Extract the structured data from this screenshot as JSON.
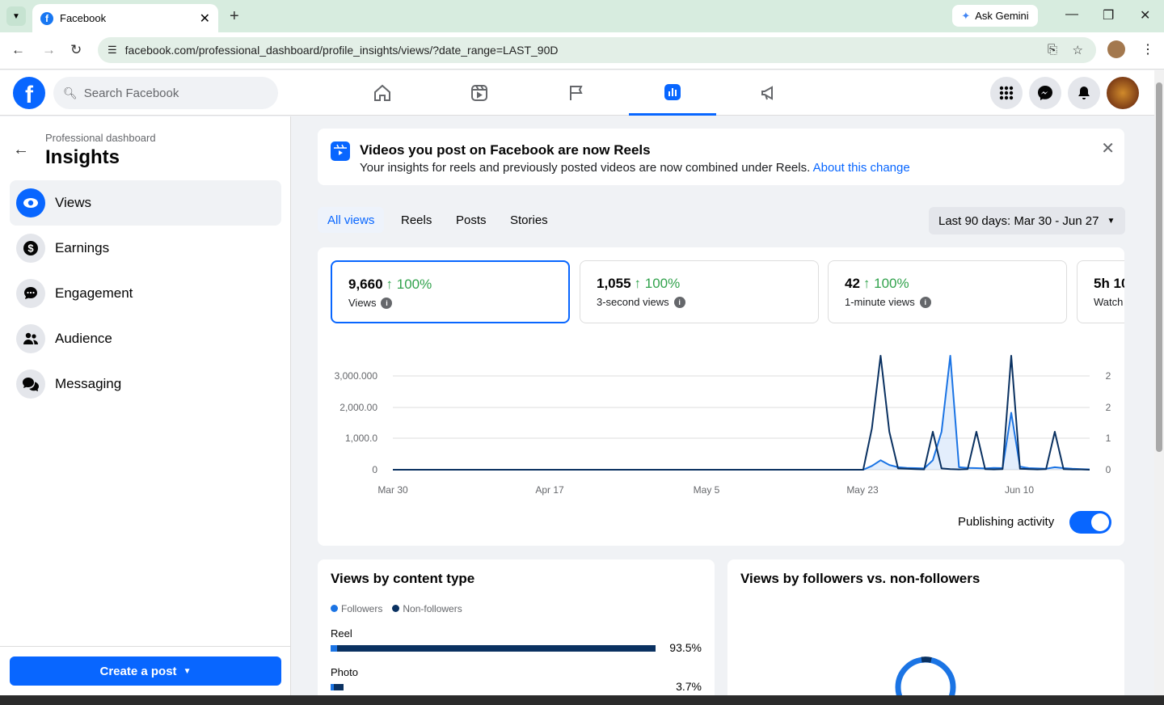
{
  "browser": {
    "tab_title": "Facebook",
    "url": "facebook.com/professional_dashboard/profile_insights/views/?date_range=LAST_90D",
    "gemini_label": "Ask Gemini"
  },
  "fb": {
    "search_placeholder": "Search Facebook"
  },
  "sidebar": {
    "breadcrumb": "Professional dashboard",
    "title": "Insights",
    "items": [
      {
        "label": "Views",
        "icon": "eye-icon"
      },
      {
        "label": "Earnings",
        "icon": "dollar-icon"
      },
      {
        "label": "Engagement",
        "icon": "chat-bubble-icon"
      },
      {
        "label": "Audience",
        "icon": "people-icon"
      },
      {
        "label": "Messaging",
        "icon": "messages-icon"
      }
    ],
    "create_post": "Create a post"
  },
  "banner": {
    "title": "Videos you post on Facebook are now Reels",
    "desc": "Your insights for reels and previously posted videos are now combined under Reels.",
    "link": "About this change"
  },
  "filters": {
    "tabs": [
      "All views",
      "Reels",
      "Posts",
      "Stories"
    ],
    "range": "Last 90 days: Mar 30 - Jun 27"
  },
  "metrics": [
    {
      "value": "9,660",
      "pct": "↑ 100%",
      "label": "Views"
    },
    {
      "value": "1,055",
      "pct": "↑ 100%",
      "label": "3-second views"
    },
    {
      "value": "42",
      "pct": "↑ 100%",
      "label": "1-minute views"
    },
    {
      "value": "5h 10",
      "pct": "",
      "label": "Watch"
    }
  ],
  "publishing_activity": "Publishing activity",
  "chart_data": {
    "type": "line",
    "x_ticks": [
      "Mar 30",
      "Apr 17",
      "May 5",
      "May 23",
      "Jun 10"
    ],
    "y_ticks_left": [
      "3,000.000",
      "2,000.00",
      "1,000.0",
      "0"
    ],
    "y_ticks_right": [
      "2",
      "2",
      "1",
      "0"
    ],
    "ylim": [
      0,
      3000
    ],
    "series": [
      {
        "color": "#1b74e4",
        "values": [
          0,
          0,
          0,
          0,
          0,
          0,
          0,
          0,
          0,
          0,
          0,
          0,
          0,
          0,
          0,
          0,
          0,
          0,
          0,
          0,
          0,
          0,
          0,
          0,
          0,
          0,
          0,
          0,
          0,
          0,
          0,
          0,
          0,
          0,
          0,
          0,
          0,
          0,
          0,
          0,
          0,
          0,
          0,
          0,
          0,
          0,
          0,
          0,
          0,
          0,
          0,
          0,
          0,
          0,
          0,
          120,
          300,
          150,
          80,
          60,
          50,
          40,
          300,
          1200,
          3600,
          80,
          60,
          50,
          40,
          60,
          50,
          1800,
          100,
          50,
          40,
          30,
          80,
          50,
          30,
          20,
          10
        ]
      },
      {
        "color": "#0a3161",
        "values": [
          0,
          0,
          0,
          0,
          0,
          0,
          0,
          0,
          0,
          0,
          0,
          0,
          0,
          0,
          0,
          0,
          0,
          0,
          0,
          0,
          0,
          0,
          0,
          0,
          0,
          0,
          0,
          0,
          0,
          0,
          0,
          0,
          0,
          0,
          0,
          0,
          0,
          0,
          0,
          0,
          0,
          0,
          0,
          0,
          0,
          0,
          0,
          0,
          0,
          0,
          0,
          0,
          0,
          0,
          0,
          1300,
          3600,
          1200,
          40,
          30,
          20,
          10,
          1200,
          40,
          20,
          10,
          20,
          1200,
          20,
          10,
          20,
          3600,
          30,
          20,
          10,
          20,
          1200,
          20,
          10,
          10,
          0
        ]
      }
    ]
  },
  "content_type": {
    "title": "Views by content type",
    "legend": [
      {
        "label": "Followers",
        "color": "#1b74e4"
      },
      {
        "label": "Non-followers",
        "color": "#0a3161"
      }
    ],
    "rows": [
      {
        "label": "Reel",
        "value": "93.5%",
        "followers": 0.02,
        "non_followers": 0.98
      },
      {
        "label": "Photo",
        "value": "3.7%",
        "followers": 0.01,
        "non_followers": 0.03
      }
    ]
  },
  "followers_card": {
    "title": "Views by followers vs. non-followers"
  }
}
